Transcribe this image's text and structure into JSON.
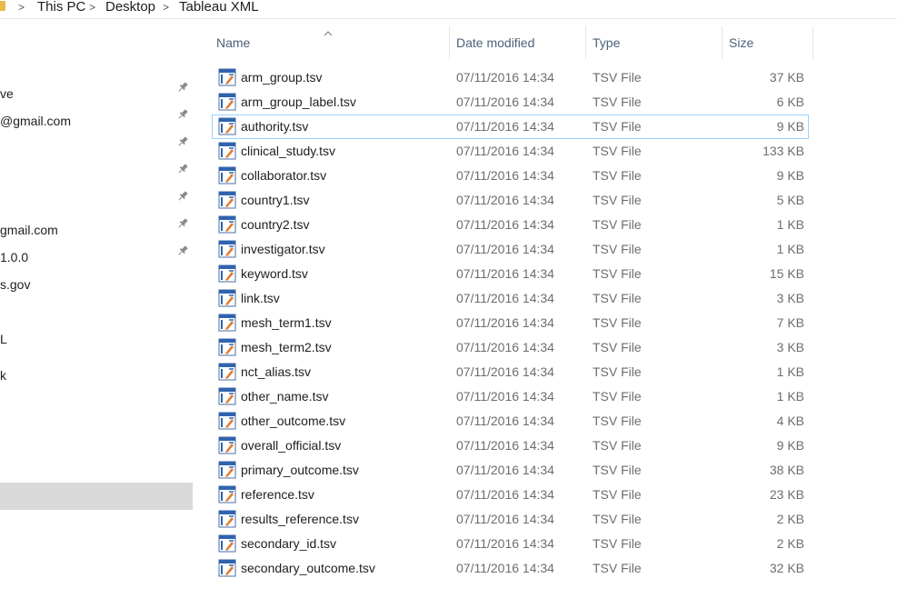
{
  "breadcrumb": {
    "items": [
      "This PC",
      "Desktop",
      "Tableau XML"
    ],
    "separator": ">"
  },
  "nav": {
    "items": [
      {
        "label": "",
        "pinned": true
      },
      {
        "label": "ve",
        "pinned": true
      },
      {
        "label": "@gmail.com",
        "pinned": true
      },
      {
        "label": "",
        "pinned": true
      },
      {
        "label": "",
        "pinned": true
      },
      {
        "label": "",
        "pinned": true
      },
      {
        "label": "gmail.com",
        "pinned": true
      },
      {
        "label": "1.0.0",
        "pinned": false
      },
      {
        "label": "s.gov",
        "pinned": false
      },
      {
        "label": "",
        "pinned": false
      },
      {
        "label": "L",
        "pinned": false
      },
      {
        "label": "",
        "pinned": false
      },
      {
        "label": "k",
        "pinned": false
      }
    ]
  },
  "columns": {
    "name": "Name",
    "date": "Date modified",
    "type": "Type",
    "size": "Size",
    "sort_icon": "sort-up-caret-icon"
  },
  "files": [
    {
      "name": "arm_group.tsv",
      "date": "07/11/2016 14:34",
      "type": "TSV File",
      "size": "37 KB"
    },
    {
      "name": "arm_group_label.tsv",
      "date": "07/11/2016 14:34",
      "type": "TSV File",
      "size": "6 KB"
    },
    {
      "name": "authority.tsv",
      "date": "07/11/2016 14:34",
      "type": "TSV File",
      "size": "9 KB"
    },
    {
      "name": "clinical_study.tsv",
      "date": "07/11/2016 14:34",
      "type": "TSV File",
      "size": "133 KB"
    },
    {
      "name": "collaborator.tsv",
      "date": "07/11/2016 14:34",
      "type": "TSV File",
      "size": "9 KB"
    },
    {
      "name": "country1.tsv",
      "date": "07/11/2016 14:34",
      "type": "TSV File",
      "size": "5 KB"
    },
    {
      "name": "country2.tsv",
      "date": "07/11/2016 14:34",
      "type": "TSV File",
      "size": "1 KB"
    },
    {
      "name": "investigator.tsv",
      "date": "07/11/2016 14:34",
      "type": "TSV File",
      "size": "1 KB"
    },
    {
      "name": "keyword.tsv",
      "date": "07/11/2016 14:34",
      "type": "TSV File",
      "size": "15 KB"
    },
    {
      "name": "link.tsv",
      "date": "07/11/2016 14:34",
      "type": "TSV File",
      "size": "3 KB"
    },
    {
      "name": "mesh_term1.tsv",
      "date": "07/11/2016 14:34",
      "type": "TSV File",
      "size": "7 KB"
    },
    {
      "name": "mesh_term2.tsv",
      "date": "07/11/2016 14:34",
      "type": "TSV File",
      "size": "3 KB"
    },
    {
      "name": "nct_alias.tsv",
      "date": "07/11/2016 14:34",
      "type": "TSV File",
      "size": "1 KB"
    },
    {
      "name": "other_name.tsv",
      "date": "07/11/2016 14:34",
      "type": "TSV File",
      "size": "1 KB"
    },
    {
      "name": "other_outcome.tsv",
      "date": "07/11/2016 14:34",
      "type": "TSV File",
      "size": "4 KB"
    },
    {
      "name": "overall_official.tsv",
      "date": "07/11/2016 14:34",
      "type": "TSV File",
      "size": "9 KB"
    },
    {
      "name": "primary_outcome.tsv",
      "date": "07/11/2016 14:34",
      "type": "TSV File",
      "size": "38 KB"
    },
    {
      "name": "reference.tsv",
      "date": "07/11/2016 14:34",
      "type": "TSV File",
      "size": "23 KB"
    },
    {
      "name": "results_reference.tsv",
      "date": "07/11/2016 14:34",
      "type": "TSV File",
      "size": "2 KB"
    },
    {
      "name": "secondary_id.tsv",
      "date": "07/11/2016 14:34",
      "type": "TSV File",
      "size": "2 KB"
    },
    {
      "name": "secondary_outcome.tsv",
      "date": "07/11/2016 14:34",
      "type": "TSV File",
      "size": "32 KB"
    }
  ],
  "focused_index": 2,
  "file_icon": "tableau-tsv-file-icon",
  "pin_icon": "pin-icon",
  "colors": {
    "header_text": "#4c607a",
    "focus_outline": "#99d1ff",
    "nav_selected": "#d9d9d9",
    "meta_text": "#6d6d6d"
  }
}
